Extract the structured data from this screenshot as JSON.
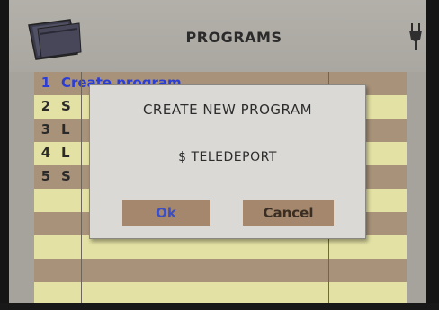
{
  "header": {
    "title": "PROGRAMS",
    "left_icon": "folder-icon",
    "right_icon": "plug-icon"
  },
  "programs": [
    {
      "num": "1",
      "name": "Create program",
      "selected": true
    },
    {
      "num": "2",
      "name": "S"
    },
    {
      "num": "3",
      "name": "L"
    },
    {
      "num": "4",
      "name": "L"
    },
    {
      "num": "5",
      "name": "S"
    }
  ],
  "dialog": {
    "title": "CREATE NEW PROGRAM",
    "program_name": "$ TELEDEPORT",
    "ok_label": "Ok",
    "cancel_label": "Cancel"
  },
  "colors": {
    "selected_text": "#2a3dd6",
    "row_dark": "#a8927a",
    "row_light": "#e3e1a3",
    "dialog_bg": "#dad9d5",
    "button_bg": "#a4876c"
  }
}
